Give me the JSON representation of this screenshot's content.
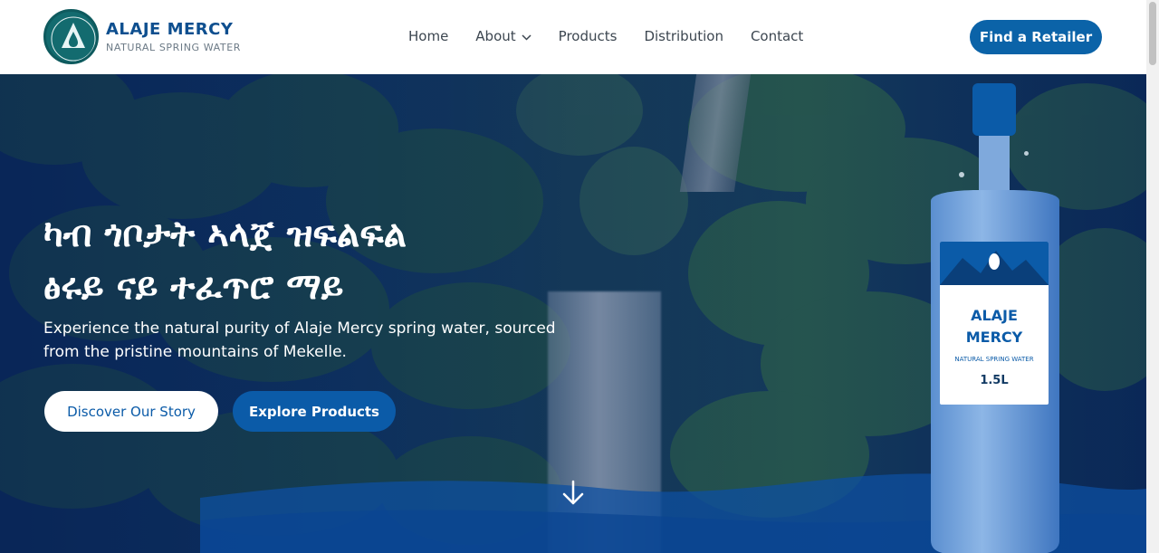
{
  "brand": {
    "name": "ALAJE MERCY",
    "tagline": "NATURAL SPRING WATER",
    "logo_icon": "water-drop-icon"
  },
  "nav": {
    "items": [
      {
        "label": "Home"
      },
      {
        "label": "About",
        "has_dropdown": true
      },
      {
        "label": "Products"
      },
      {
        "label": "Distribution"
      },
      {
        "label": "Contact"
      }
    ],
    "cta_label": "Find a Retailer"
  },
  "hero": {
    "headline_line1": "ካብ ጎቦታት ኣላጀ ዝፍልፍል",
    "headline_line2": "ፅሩይ ናይ ተፈጥሮ ማይ",
    "subtext_line1": "Experience the natural purity of Alaje Mercy spring water, sourced",
    "subtext_line2": "from the pristine mountains of Mekelle.",
    "primary_button": "Discover Our Story",
    "secondary_button": "Explore Products",
    "scroll_icon": "arrow-down-icon"
  },
  "bottle": {
    "label_line1": "ALAJE",
    "label_line2": "MERCY",
    "label_tagline": "NATURAL SPRING WATER",
    "volume": "1.5L"
  },
  "colors": {
    "primary": "#0b5ba8",
    "brand_text": "#0e4f8f",
    "logo_bg": "#136b6f",
    "hero_overlay": "#0b2e5e"
  }
}
